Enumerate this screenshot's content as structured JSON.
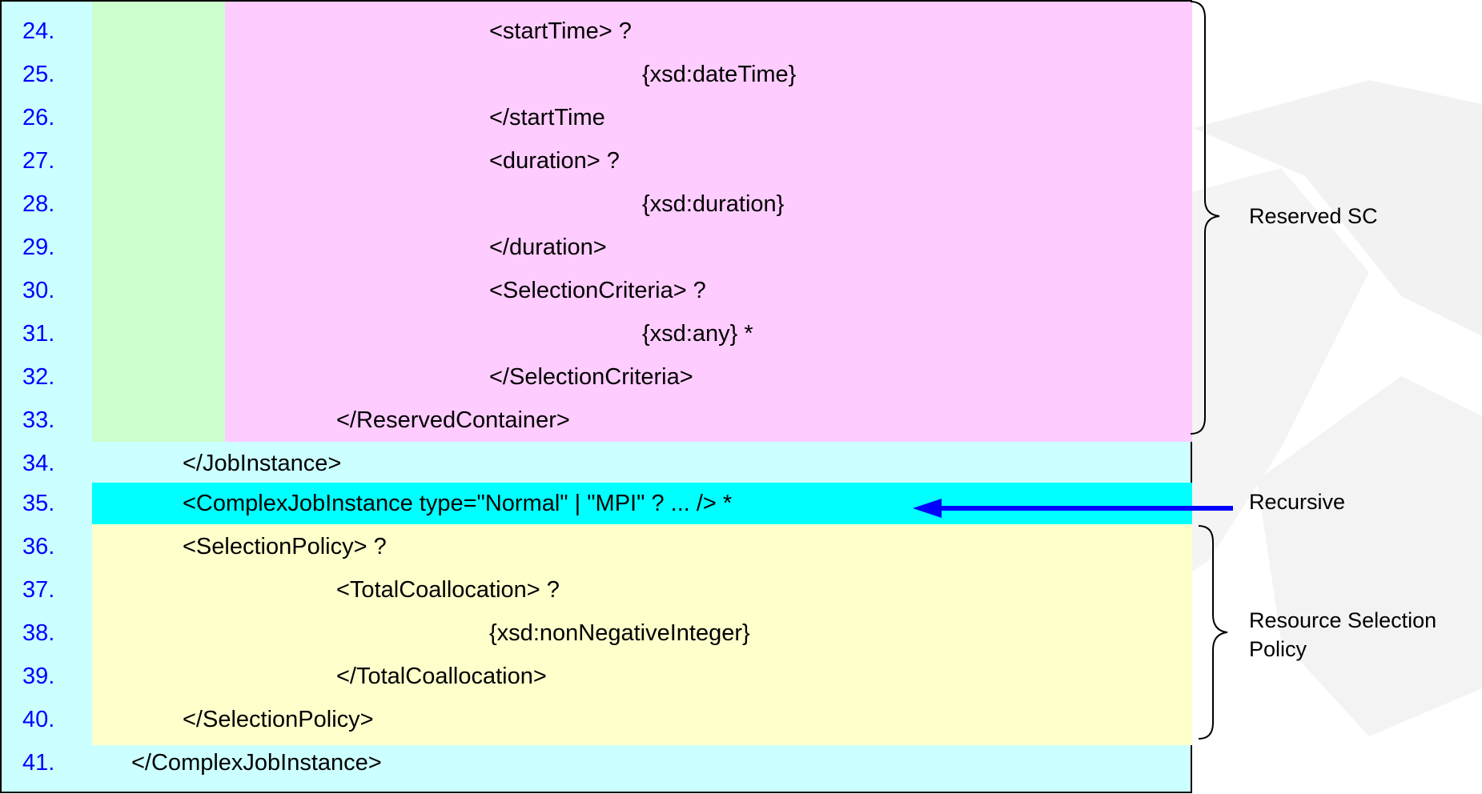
{
  "listing": {
    "lines": [
      {
        "no": "24.",
        "code": "<startTime> ?"
      },
      {
        "no": "25.",
        "code": "{xsd:dateTime}"
      },
      {
        "no": "26.",
        "code": "</startTime"
      },
      {
        "no": "27.",
        "code": "<duration> ?"
      },
      {
        "no": "28.",
        "code": "{xsd:duration}"
      },
      {
        "no": "29.",
        "code": "</duration>"
      },
      {
        "no": "30.",
        "code": "<SelectionCriteria> ?"
      },
      {
        "no": "31.",
        "code": "{xsd:any} *"
      },
      {
        "no": "32.",
        "code": "</SelectionCriteria>"
      },
      {
        "no": "33.",
        "code": "</ReservedContainer>"
      },
      {
        "no": "34.",
        "code": "</JobInstance>"
      },
      {
        "no": "35.",
        "code": "<ComplexJobInstance type=\"Normal\" | \"MPI\" ? ... /> *"
      },
      {
        "no": "36.",
        "code": "<SelectionPolicy> ?"
      },
      {
        "no": "37.",
        "code": "<TotalCoallocation> ?"
      },
      {
        "no": "38.",
        "code": "{xsd:nonNegativeInteger}"
      },
      {
        "no": "39.",
        "code": "</TotalCoallocation>"
      },
      {
        "no": "40.",
        "code": "</SelectionPolicy>"
      },
      {
        "no": "41.",
        "code": "</ComplexJobInstance>"
      }
    ]
  },
  "annotations": {
    "reserved_sc": "Reserved SC",
    "recursive": "Recursive",
    "resource_selection_line1": "Resource Selection",
    "resource_selection_line2": "Policy"
  },
  "colors": {
    "line_number": "#0000ff",
    "green_band": "#ccffcc",
    "pink_band": "#ffccff",
    "cyan_highlight": "#00ffff",
    "yellow_band": "#ffffcc",
    "panel_background": "#ccffff",
    "arrow": "#0000ff"
  }
}
